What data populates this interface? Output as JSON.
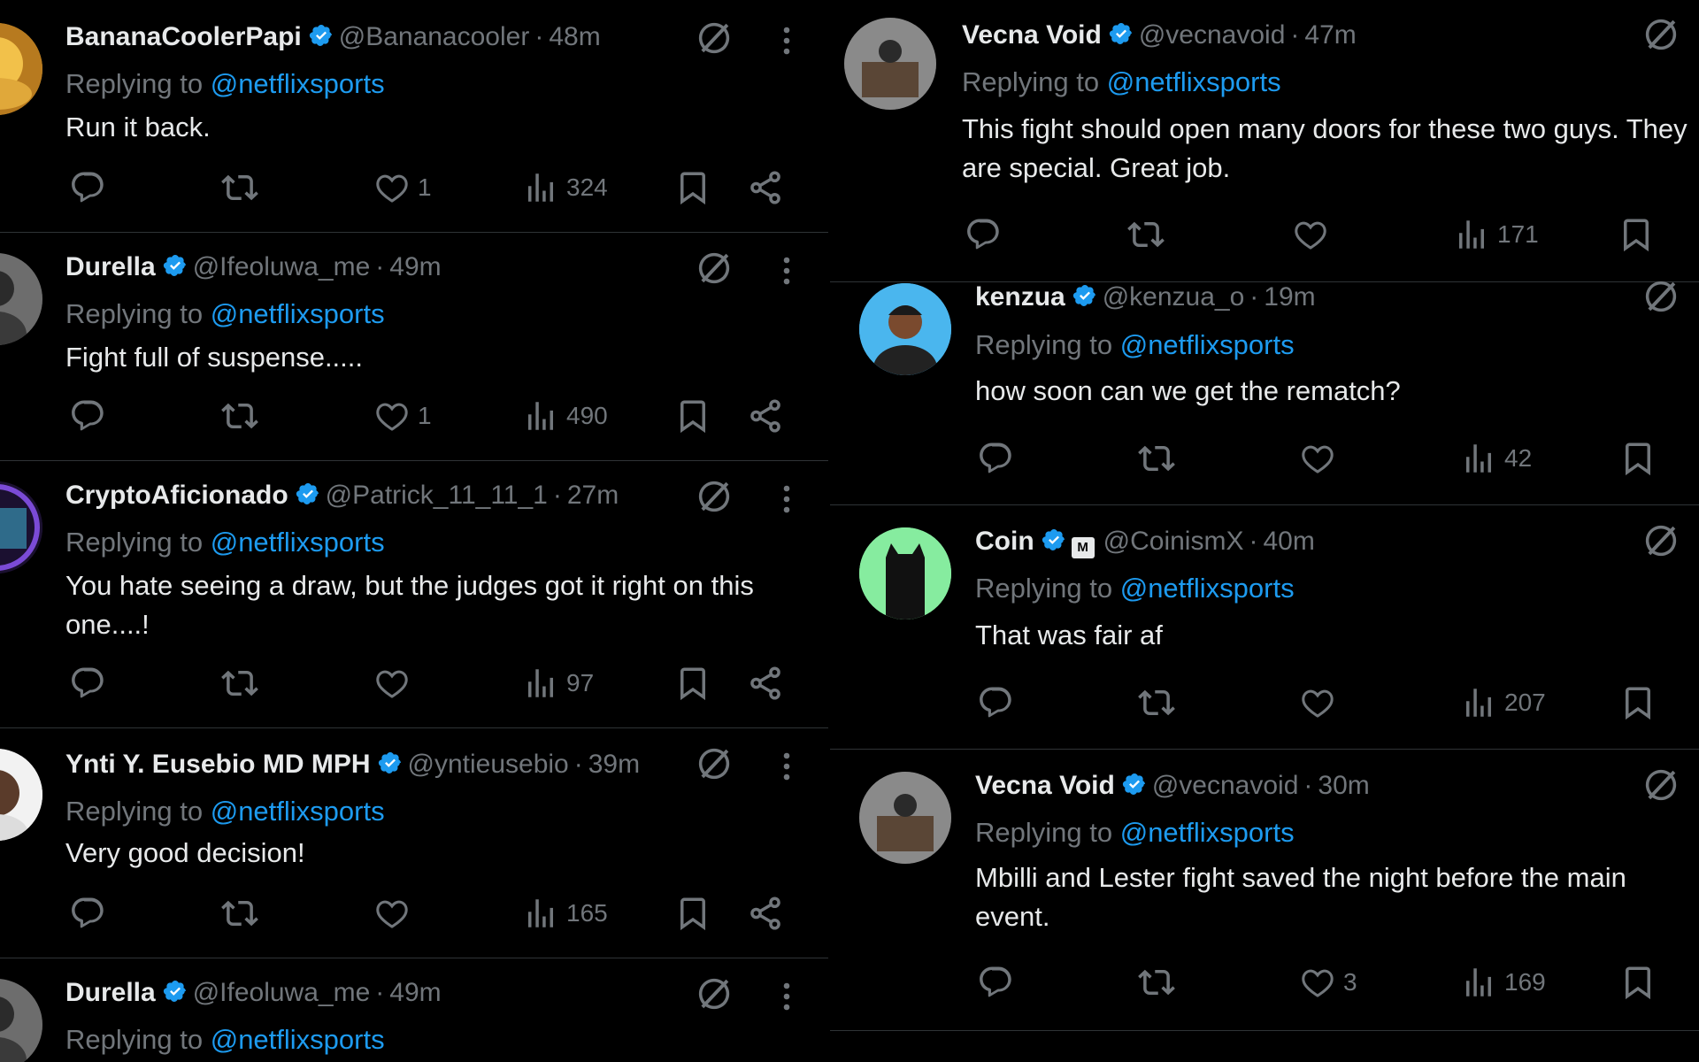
{
  "left_column": {
    "tweets": [
      {
        "name": "BananaCoolerPapi",
        "handle": "@Bananacooler",
        "time": "48m",
        "replying_label": "Replying to",
        "mention": "@netflixsports",
        "text": "Run it back.",
        "likes": "1",
        "views": "324"
      },
      {
        "name": "Durella",
        "handle": "@Ifeoluwa_me",
        "time": "49m",
        "replying_label": "Replying to",
        "mention": "@netflixsports",
        "text": "Fight full of suspense.....",
        "likes": "1",
        "views": "490"
      },
      {
        "name": "CryptoAficionado",
        "handle": "@Patrick_11_11_1",
        "time": "27m",
        "replying_label": "Replying to",
        "mention": "@netflixsports",
        "text": "You hate seeing a draw, but the judges got it right on this one....!",
        "likes": "",
        "views": "97"
      },
      {
        "name": "Ynti Y. Eusebio MD MPH",
        "handle": "@yntieusebio",
        "time": "39m",
        "replying_label": "Replying to",
        "mention": "@netflixsports",
        "text": "Very good decision!",
        "likes": "",
        "views": "165"
      },
      {
        "name": "Durella",
        "handle": "@Ifeoluwa_me",
        "time": "49m",
        "replying_label": "Replying to",
        "mention": "@netflixsports",
        "text": "",
        "likes": "",
        "views": ""
      }
    ]
  },
  "right_column": {
    "tweets": [
      {
        "name": "Vecna Void",
        "handle": "@vecnavoid",
        "time": "47m",
        "replying_label": "Replying to",
        "mention": "@netflixsports",
        "text": "This fight should open many doors for these two guys. They are special. Great job.",
        "likes": "",
        "views": "171"
      },
      {
        "name": "kenzua",
        "handle": "@kenzua_o",
        "time": "19m",
        "replying_label": "Replying to",
        "mention": "@netflixsports",
        "text": "how soon can we get the rematch?",
        "likes": "",
        "views": "42"
      },
      {
        "name": "Coin",
        "handle": "@CoinismX",
        "time": "40m",
        "replying_label": "Replying to",
        "mention": "@netflixsports",
        "text": "That was fair af",
        "likes": "",
        "views": "207"
      },
      {
        "name": "Vecna Void",
        "handle": "@vecnavoid",
        "time": "30m",
        "replying_label": "Replying to",
        "mention": "@netflixsports",
        "text": "Mbilli and Lester fight saved the night before the main event.",
        "likes": "3",
        "views": "169"
      }
    ]
  },
  "time_separator": "·",
  "colors": {
    "background": "#000000",
    "text": "#e7e9ea",
    "muted": "#71767b",
    "accent": "#1d9bf0",
    "border": "#2f3336"
  },
  "icons": [
    "reply-icon",
    "retweet-icon",
    "like-icon",
    "views-icon",
    "bookmark-icon",
    "share-icon",
    "grok-icon",
    "more-icon",
    "verified-icon"
  ]
}
